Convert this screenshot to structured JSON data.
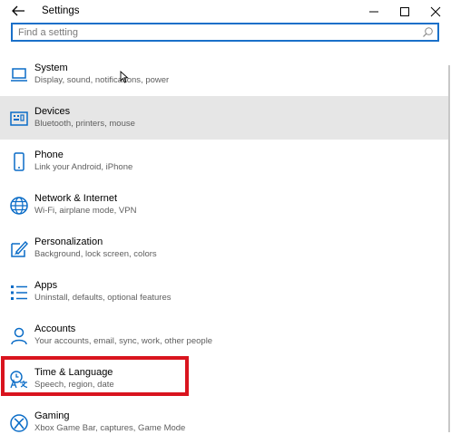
{
  "window": {
    "title": "Settings"
  },
  "search": {
    "placeholder": "Find a setting",
    "value": ""
  },
  "categories": [
    {
      "label": "System",
      "desc": "Display, sound, notifications, power",
      "icon": "laptop-icon"
    },
    {
      "label": "Devices",
      "desc": "Bluetooth, printers, mouse",
      "icon": "keyboard-icon",
      "hovered": true
    },
    {
      "label": "Phone",
      "desc": "Link your Android, iPhone",
      "icon": "phone-icon"
    },
    {
      "label": "Network & Internet",
      "desc": "Wi-Fi, airplane mode, VPN",
      "icon": "globe-icon"
    },
    {
      "label": "Personalization",
      "desc": "Background, lock screen, colors",
      "icon": "paintbrush-icon"
    },
    {
      "label": "Apps",
      "desc": "Uninstall, defaults, optional features",
      "icon": "apps-list-icon"
    },
    {
      "label": "Accounts",
      "desc": "Your accounts, email, sync, work, other people",
      "icon": "person-icon"
    },
    {
      "label": "Time & Language",
      "desc": "Speech, region, date",
      "icon": "time-language-icon",
      "highlighted": true
    },
    {
      "label": "Gaming",
      "desc": "Xbox Game Bar, captures, Game Mode",
      "icon": "xbox-icon"
    }
  ],
  "colors": {
    "accent": "#0a6cc7",
    "search_border": "#1a70c9",
    "highlight": "#d9141e",
    "hover": "#e6e6e6"
  }
}
